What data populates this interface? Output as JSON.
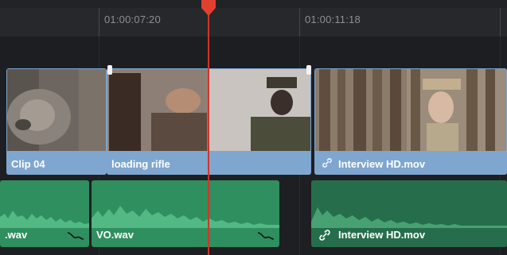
{
  "timeline": {
    "timecodes": [
      "01:00:07:20",
      "01:00:11:18"
    ],
    "accent": "#e0402e"
  },
  "video_track": {
    "clips": [
      {
        "name": "Clip 04"
      },
      {
        "name": "loading rifle"
      },
      {
        "name": "Interview HD.mov",
        "linked": true
      }
    ],
    "color": "#7fa6cf"
  },
  "audio_track": {
    "clips": [
      {
        "name": ".wav",
        "icon": "fade-icon"
      },
      {
        "name": "VO.wav",
        "icon": "fade-icon"
      },
      {
        "name": "Interview HD.mov",
        "icon": "link-icon"
      }
    ],
    "color": "#2f8f5f"
  }
}
